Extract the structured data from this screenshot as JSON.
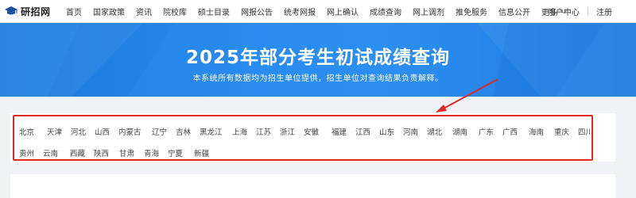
{
  "logo": {
    "text": "研招网"
  },
  "nav": {
    "items": [
      "首页",
      "国家政策",
      "资讯",
      "院校库",
      "硕士目录",
      "网报公告",
      "统考网报",
      "网上确认",
      "成绩查询",
      "网上调剂",
      "推免服务",
      "信息公开"
    ],
    "more": "更多",
    "user_center": "用户中心",
    "register": "注册"
  },
  "banner": {
    "title": "2025年部分考生初试成绩查询",
    "subtitle": "本系统所有数据均为招生单位提供，招生单位对查询结果负责解释。"
  },
  "regions": {
    "row1": [
      "北京",
      "天津",
      "河北",
      "山西",
      "内蒙古",
      "辽宁",
      "吉林",
      "黑龙江",
      "上海",
      "江苏",
      "浙江",
      "安徽",
      "福建",
      "江西",
      "山东",
      "河南",
      "湖北",
      "湖南",
      "广东",
      "广西",
      "海南",
      "重庆",
      "四川"
    ],
    "row2": [
      "贵州",
      "云南",
      "西藏",
      "陕西",
      "甘肃",
      "青海",
      "宁夏",
      "新疆"
    ]
  },
  "colors": {
    "banner": "#2a8cf0",
    "highlight": "#e02a2a",
    "arrow": "#e02a2a"
  }
}
